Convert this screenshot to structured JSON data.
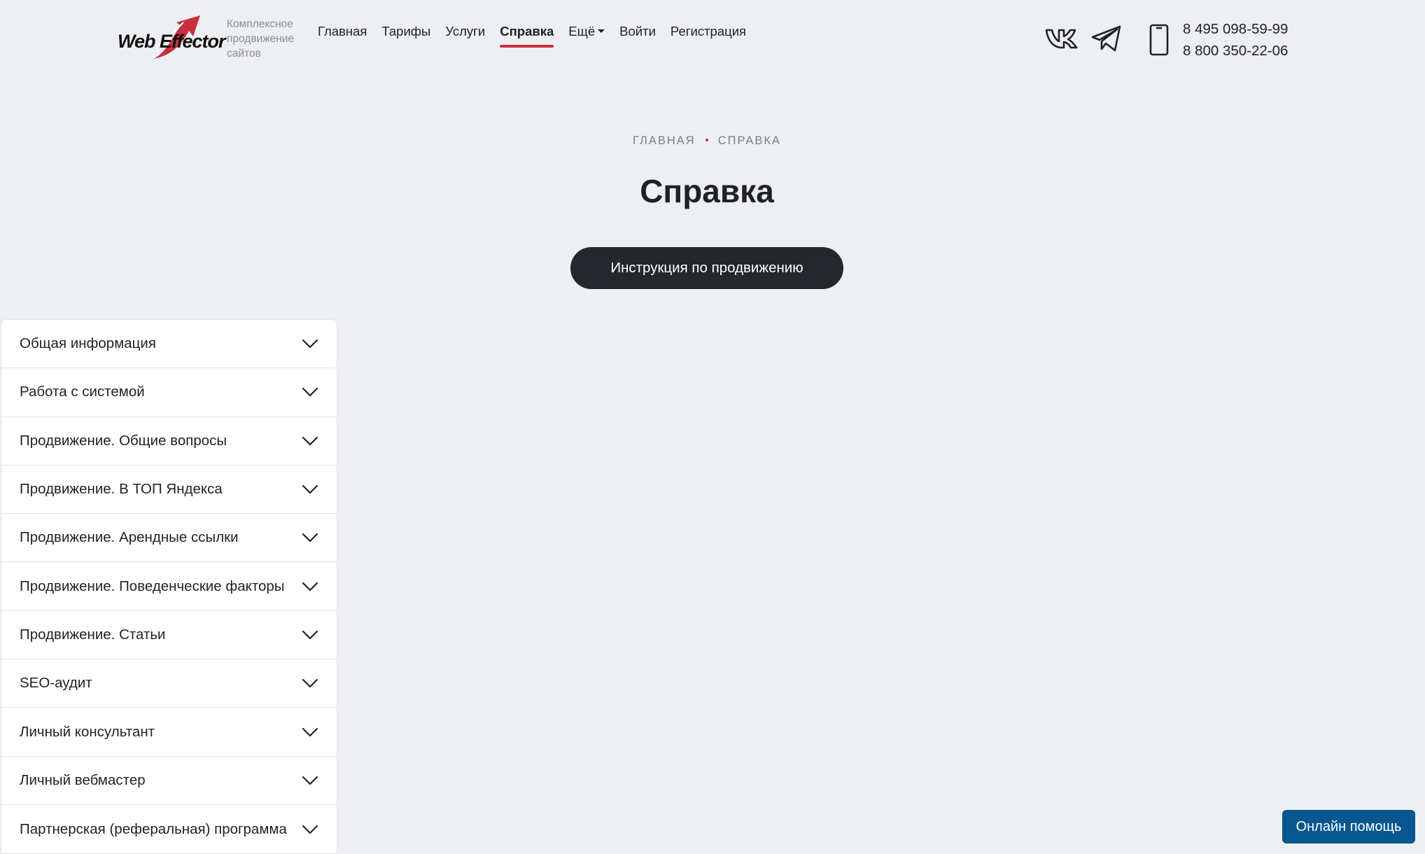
{
  "brand": {
    "name": "Web Effector",
    "tagline": "Комплексное продвижение сайтов",
    "accent_color": "#c8303f"
  },
  "nav": {
    "items": [
      {
        "label": "Главная",
        "active": false
      },
      {
        "label": "Тарифы",
        "active": false
      },
      {
        "label": "Услуги",
        "active": false
      },
      {
        "label": "Справка",
        "active": true
      },
      {
        "label": "Ещё",
        "active": false,
        "dropdown": true
      },
      {
        "label": "Войти",
        "active": false
      },
      {
        "label": "Регистрация",
        "active": false
      }
    ]
  },
  "social": {
    "vk_icon": "vk-icon",
    "telegram_icon": "telegram-icon"
  },
  "contacts": {
    "phone_icon": "smartphone-icon",
    "phones": [
      "8 495 098-59-99",
      "8 800 350-22-06"
    ]
  },
  "breadcrumb": {
    "items": [
      "ГЛАВНАЯ",
      "СПРАВКА"
    ]
  },
  "page": {
    "title": "Справка",
    "cta_label": "Инструкция по продвижению"
  },
  "accordion": {
    "items": [
      "Общая информация",
      "Работа с системой",
      "Продвижение. Общие вопросы",
      "Продвижение. В ТОП Яндекса",
      "Продвижение. Арендные ссылки",
      "Продвижение. Поведенческие факторы",
      "Продвижение. Статьи",
      "SEO-аудит",
      "Личный консультант",
      "Личный вебмастер",
      "Партнерская (реферальная) программа"
    ]
  },
  "help": {
    "label": "Онлайн помощь",
    "color": "#07568f"
  }
}
